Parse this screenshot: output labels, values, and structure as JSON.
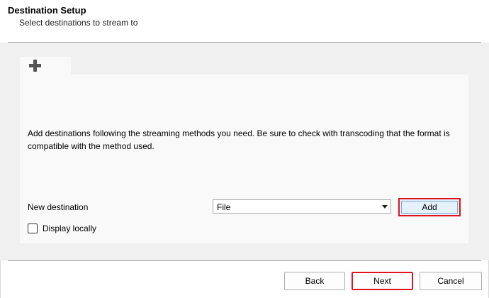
{
  "header": {
    "title": "Destination Setup",
    "subtitle": "Select destinations to stream to"
  },
  "tabs": [
    {
      "icon": "plus-icon"
    }
  ],
  "main": {
    "description": "Add destinations following the streaming methods you need. Be sure to check with transcoding that the format is compatible with the method used.",
    "new_destination_label": "New destination",
    "destination_select": {
      "value": "File"
    },
    "add_label": "Add",
    "display_locally_label": "Display locally",
    "display_locally_checked": false
  },
  "footer": {
    "back_label": "Back",
    "next_label": "Next",
    "cancel_label": "Cancel"
  },
  "colors": {
    "highlight": "#e0141e",
    "panel_bg": "#f9f9f9",
    "body_bg": "#f0f0f0"
  }
}
